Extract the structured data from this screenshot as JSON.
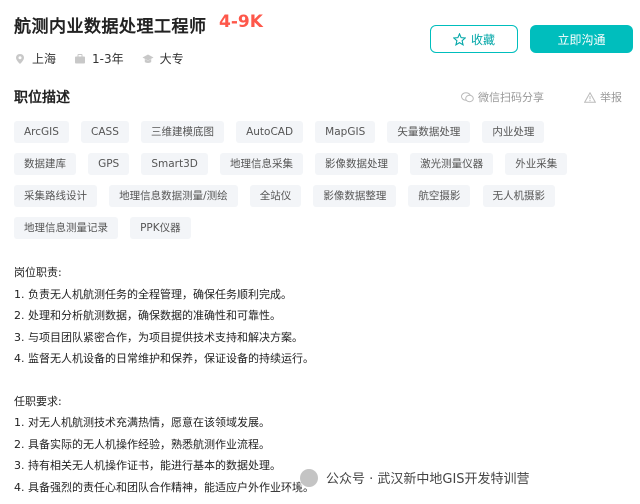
{
  "job": {
    "title": "航测内业数据处理工程师",
    "salary": "4-9K",
    "location": "上海",
    "experience": "1-3年",
    "education": "大专"
  },
  "actions": {
    "favorite_label": "收藏",
    "chat_label": "立即沟通"
  },
  "section": {
    "title": "职位描述",
    "share_label": "微信扫码分享",
    "report_label": "举报"
  },
  "tags": [
    "ArcGIS",
    "CASS",
    "三维建模底图",
    "AutoCAD",
    "MapGIS",
    "矢量数据处理",
    "内业处理",
    "数据建库",
    "GPS",
    "Smart3D",
    "地理信息采集",
    "影像数据处理",
    "激光测量仪器",
    "外业采集",
    "采集路线设计",
    "地理信息数据测量/测绘",
    "全站仪",
    "影像数据整理",
    "航空摄影",
    "无人机摄影",
    "地理信息测量记录",
    "PPK仪器"
  ],
  "description": {
    "duties_title": "岗位职责:",
    "duties": [
      "1. 负责无人机航测任务的全程管理，确保任务顺利完成。",
      "2. 处理和分析航测数据，确保数据的准确性和可靠性。",
      "3. 与项目团队紧密合作，为项目提供技术支持和解决方案。",
      "4. 监督无人机设备的日常维护和保养，保证设备的持续运行。"
    ],
    "requirements_title": "任职要求:",
    "requirements": [
      "1. 对无人机航测技术充满热情，愿意在该领域发展。",
      "2. 具备实际的无人机操作经验，熟悉航测作业流程。",
      "3. 持有相关无人机操作证书，能进行基本的数据处理。",
      "4. 具备强烈的责任心和团队合作精神，能适应户外作业环境。"
    ]
  },
  "watermark": "公众号 · 武汉新中地GIS开发特训营"
}
